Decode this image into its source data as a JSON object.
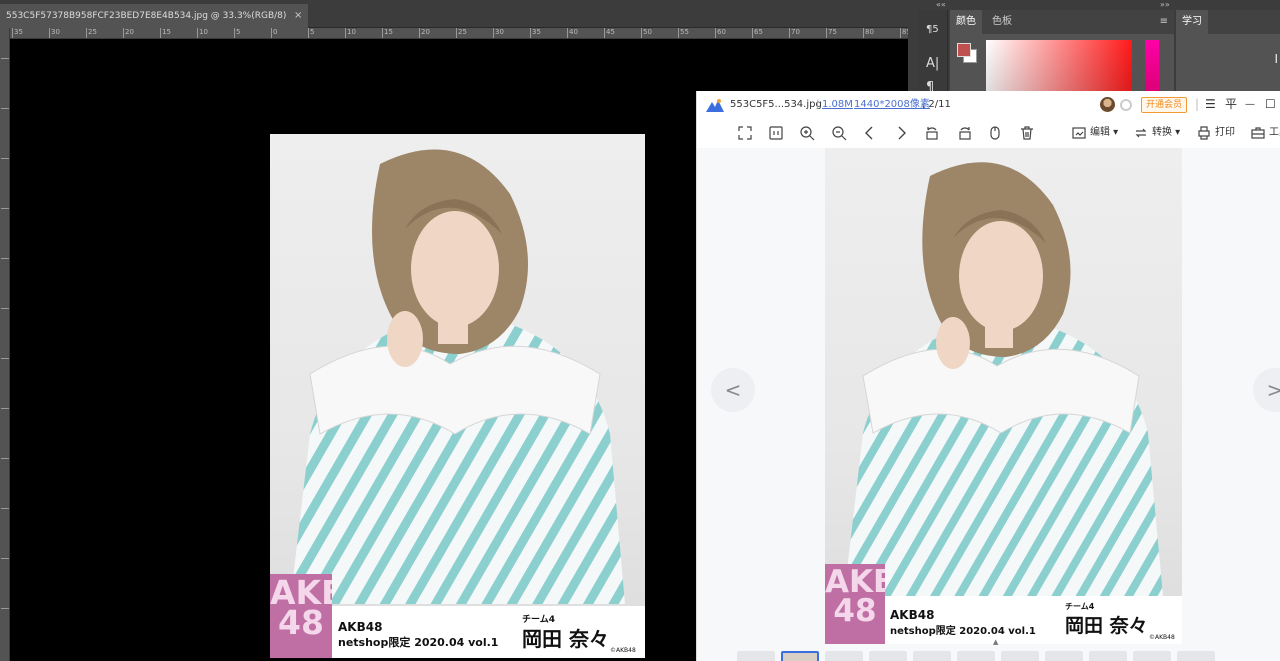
{
  "photoshop": {
    "doc_tab_title": "553C5F57378B958FCF23BED7E8E4B534.jpg @ 33.3%(RGB/8)",
    "doc_tab_close": "×",
    "ruler_ticks": [
      "35",
      "30",
      "25",
      "20",
      "15",
      "10",
      "5",
      "0",
      "5",
      "10",
      "15",
      "20",
      "25",
      "30",
      "35",
      "40",
      "45",
      "50",
      "55",
      "60",
      "65",
      "70",
      "75",
      "80",
      "85"
    ],
    "panel_collapse": "««",
    "panel_collapse_right": "»»",
    "tools": [
      "¶5",
      "A|",
      "¶"
    ],
    "color_panel_tabs": [
      "颜色",
      "色板"
    ],
    "panel_menu": "≡",
    "learn_panel_tab": "学习",
    "learn_panel_glyph": "I",
    "fg_color": "#c0504d",
    "hue_color": "#ff00a8"
  },
  "photo_card": {
    "logo_line1": "AKB",
    "logo_line2": "48",
    "line1": "AKB48",
    "line2": "netshop限定  2020.04 vol.1",
    "team": "チーム4",
    "name": "岡田 奈々",
    "copyright": "©AKB48"
  },
  "viewer": {
    "filename": "553C5F5...534.jpg",
    "filesize": "1.08M",
    "dimensions": "1440*2008像素",
    "page_counter": ", 2/11",
    "vip_label": "开通会员",
    "menu_icon": "☰",
    "pin_icon": "平",
    "minimize_icon": "—",
    "maximize_icon": "☐",
    "toolbar": {
      "edit": "编辑",
      "convert": "转换",
      "print": "打印",
      "tools": "工具"
    },
    "prev_arrow": "<",
    "next_arrow": ">"
  }
}
